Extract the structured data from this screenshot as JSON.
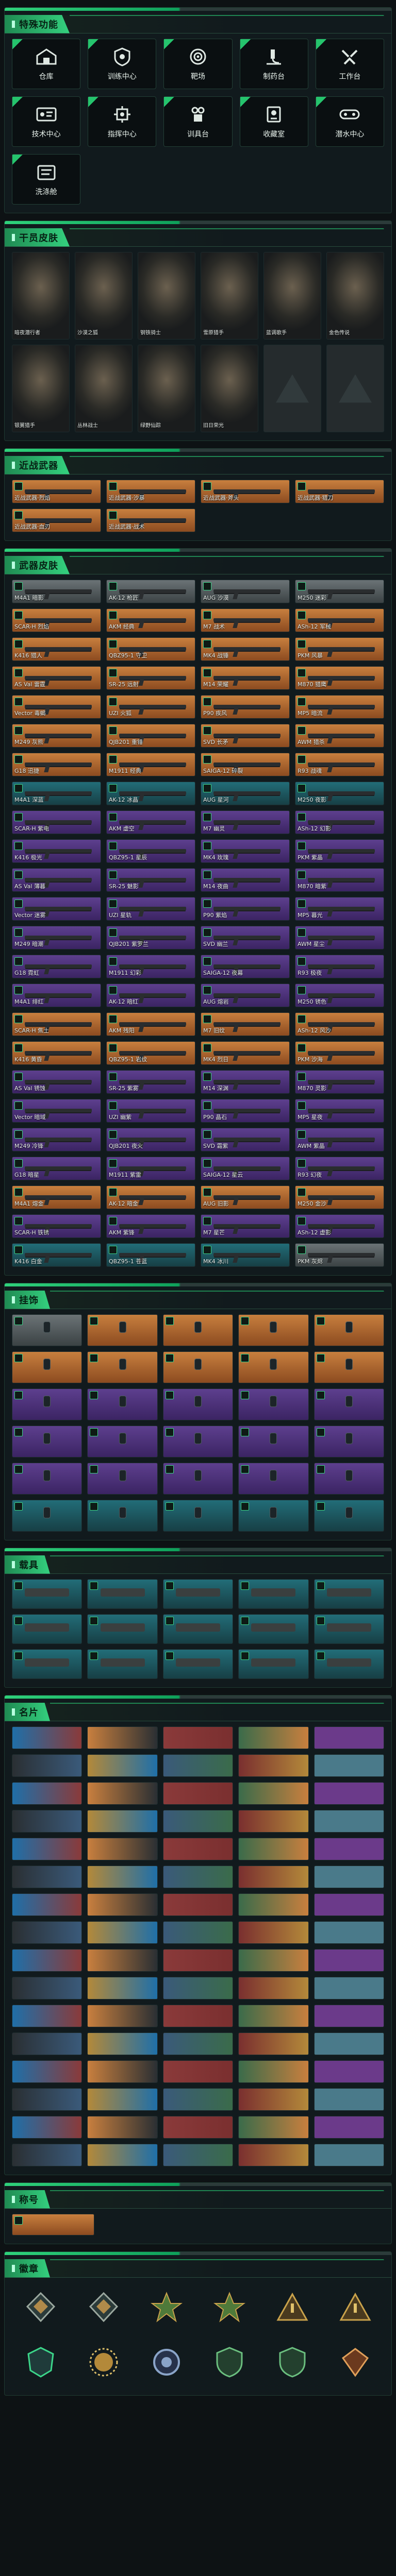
{
  "window": {
    "title": "特殊功能"
  },
  "functions": {
    "title": "特殊功能",
    "items": [
      {
        "label": "仓库",
        "icon": "warehouse-icon"
      },
      {
        "label": "训练中心",
        "icon": "training-icon"
      },
      {
        "label": "靶场",
        "icon": "target-icon"
      },
      {
        "label": "制药台",
        "icon": "microscope-icon"
      },
      {
        "label": "工作台",
        "icon": "workbench-icon"
      },
      {
        "label": "技术中心",
        "icon": "id-card-icon"
      },
      {
        "label": "指挥中心",
        "icon": "chip-icon"
      },
      {
        "label": "训具台",
        "icon": "crafting-icon"
      },
      {
        "label": "收藏室",
        "icon": "collection-icon"
      },
      {
        "label": "潜水中心",
        "icon": "diving-icon"
      },
      {
        "label": "洗涤舱",
        "icon": "wash-icon"
      }
    ]
  },
  "operators": {
    "title": "干员皮肤",
    "items": [
      {
        "label": "暗夜潜行者"
      },
      {
        "label": "沙漠之狐"
      },
      {
        "label": "钢铁骑士"
      },
      {
        "label": "雪原猎手"
      },
      {
        "label": "蓝调歌手"
      },
      {
        "label": "金色传说"
      },
      {
        "label": "银翼猎手"
      },
      {
        "label": "丛林战士"
      },
      {
        "label": "绿野仙踪"
      },
      {
        "label": "旧日荣光"
      },
      {
        "label": ""
      },
      {
        "label": ""
      }
    ]
  },
  "melee": {
    "title": "近战武器",
    "items": [
      {
        "label": "近战武器·烈焰",
        "q": "orange"
      },
      {
        "label": "近战武器·沙暴",
        "q": "orange"
      },
      {
        "label": "近战武器·斧头",
        "q": "orange"
      },
      {
        "label": "近战武器·猎刀",
        "q": "orange"
      },
      {
        "label": "近战武器·血刃",
        "q": "orange"
      },
      {
        "label": "近战武器·战术",
        "q": "orange"
      }
    ]
  },
  "weapons": {
    "title": "武器皮肤",
    "items": [
      {
        "label": "M4A1 暗影",
        "q": "gray"
      },
      {
        "label": "AK-12 枪匠",
        "q": "gray"
      },
      {
        "label": "AUG 沙漠",
        "q": "gray"
      },
      {
        "label": "M250 迷彩",
        "q": "gray"
      },
      {
        "label": "SCAR-H 烈焰",
        "q": "orange"
      },
      {
        "label": "AKM 经典",
        "q": "orange"
      },
      {
        "label": "M7 战术",
        "q": "orange"
      },
      {
        "label": "ASh-12 军械",
        "q": "orange"
      },
      {
        "label": "K416 猎人",
        "q": "orange"
      },
      {
        "label": "QBZ95-1 守卫",
        "q": "orange"
      },
      {
        "label": "MK4 战锤",
        "q": "orange"
      },
      {
        "label": "PKM 风暴",
        "q": "orange"
      },
      {
        "label": "AS Val 雷霆",
        "q": "orange"
      },
      {
        "label": "SR-25 远射",
        "q": "orange"
      },
      {
        "label": "M14 荣耀",
        "q": "orange"
      },
      {
        "label": "M870 猎鹰",
        "q": "orange"
      },
      {
        "label": "Vector 毒蝎",
        "q": "orange"
      },
      {
        "label": "UZI 火狐",
        "q": "orange"
      },
      {
        "label": "P90 疾风",
        "q": "orange"
      },
      {
        "label": "MP5 暗流",
        "q": "orange"
      },
      {
        "label": "M249 灰熊",
        "q": "orange"
      },
      {
        "label": "QJB201 重锤",
        "q": "orange"
      },
      {
        "label": "SVD 长矛",
        "q": "orange"
      },
      {
        "label": "AWM 猎杀",
        "q": "orange"
      },
      {
        "label": "G18 迅捷",
        "q": "orange"
      },
      {
        "label": "M1911 经典",
        "q": "orange"
      },
      {
        "label": "SAIGA-12 碎裂",
        "q": "orange"
      },
      {
        "label": "R93 战魂",
        "q": "orange"
      },
      {
        "label": "M4A1 深蓝",
        "q": "blue"
      },
      {
        "label": "AK-12 冰晶",
        "q": "blue"
      },
      {
        "label": "AUG 星河",
        "q": "blue"
      },
      {
        "label": "M250 夜影",
        "q": "blue"
      },
      {
        "label": "SCAR-H 紫电",
        "q": "purple"
      },
      {
        "label": "AKM 虚空",
        "q": "purple"
      },
      {
        "label": "M7 幽灵",
        "q": "purple"
      },
      {
        "label": "ASh-12 幻影",
        "q": "purple"
      },
      {
        "label": "K416 极光",
        "q": "purple"
      },
      {
        "label": "QBZ95-1 星辰",
        "q": "purple"
      },
      {
        "label": "MK4 玫瑰",
        "q": "purple"
      },
      {
        "label": "PKM 紫晶",
        "q": "purple"
      },
      {
        "label": "AS Val 薄暮",
        "q": "purple"
      },
      {
        "label": "SR-25 魅影",
        "q": "purple"
      },
      {
        "label": "M14 夜曲",
        "q": "purple"
      },
      {
        "label": "M870 暗紫",
        "q": "purple"
      },
      {
        "label": "Vector 迷雾",
        "q": "purple"
      },
      {
        "label": "UZI 星轨",
        "q": "purple"
      },
      {
        "label": "P90 紫焰",
        "q": "purple"
      },
      {
        "label": "MP5 暮光",
        "q": "purple"
      },
      {
        "label": "M249 暗潮",
        "q": "purple"
      },
      {
        "label": "QJB201 紫罗兰",
        "q": "purple"
      },
      {
        "label": "SVD 幽兰",
        "q": "purple"
      },
      {
        "label": "AWM 星尘",
        "q": "purple"
      },
      {
        "label": "G18 霓虹",
        "q": "purple"
      },
      {
        "label": "M1911 幻彩",
        "q": "purple"
      },
      {
        "label": "SAIGA-12 夜幕",
        "q": "purple"
      },
      {
        "label": "R93 极夜",
        "q": "purple"
      },
      {
        "label": "M4A1 绯红",
        "q": "purple"
      },
      {
        "label": "AK-12 暗红",
        "q": "purple"
      },
      {
        "label": "AUG 熔岩",
        "q": "purple"
      },
      {
        "label": "M250 锈色",
        "q": "purple"
      },
      {
        "label": "SCAR-H 焦土",
        "q": "orange"
      },
      {
        "label": "AKM 残阳",
        "q": "orange"
      },
      {
        "label": "M7 旧纹",
        "q": "orange"
      },
      {
        "label": "ASh-12 风沙",
        "q": "orange"
      },
      {
        "label": "K416 黄昏",
        "q": "orange"
      },
      {
        "label": "QBZ95-1 岩纹",
        "q": "orange"
      },
      {
        "label": "MK4 烈日",
        "q": "orange"
      },
      {
        "label": "PKM 沙海",
        "q": "orange"
      },
      {
        "label": "AS Val 锈蚀",
        "q": "purple"
      },
      {
        "label": "SR-25 紫雾",
        "q": "purple"
      },
      {
        "label": "M14 深渊",
        "q": "purple"
      },
      {
        "label": "M870 灵影",
        "q": "purple"
      },
      {
        "label": "Vector 暗域",
        "q": "purple"
      },
      {
        "label": "UZI 幽紫",
        "q": "purple"
      },
      {
        "label": "P90 晶石",
        "q": "purple"
      },
      {
        "label": "MP5 星夜",
        "q": "purple"
      },
      {
        "label": "M249 冷锋",
        "q": "purple"
      },
      {
        "label": "QJB201 夜火",
        "q": "purple"
      },
      {
        "label": "SVD 霜紫",
        "q": "purple"
      },
      {
        "label": "AWM 紫晶",
        "q": "purple"
      },
      {
        "label": "G18 暗星",
        "q": "purple"
      },
      {
        "label": "M1911 紫雷",
        "q": "purple"
      },
      {
        "label": "SAIGA-12 星云",
        "q": "purple"
      },
      {
        "label": "R93 幻夜",
        "q": "purple"
      },
      {
        "label": "M4A1 熔金",
        "q": "orange"
      },
      {
        "label": "AK-12 暗金",
        "q": "orange"
      },
      {
        "label": "AUG 旧影",
        "q": "orange"
      },
      {
        "label": "M250 金沙",
        "q": "orange"
      },
      {
        "label": "SCAR-H 铁锈",
        "q": "purple"
      },
      {
        "label": "AKM 紫锋",
        "q": "purple"
      },
      {
        "label": "M7 星芒",
        "q": "purple"
      },
      {
        "label": "ASh-12 虚影",
        "q": "purple"
      },
      {
        "label": "K416 白金",
        "q": "blue"
      },
      {
        "label": "QBZ95-1 苍蓝",
        "q": "blue"
      },
      {
        "label": "MK4 冰川",
        "q": "blue"
      },
      {
        "label": "PKM 灰烬",
        "q": "gray"
      }
    ]
  },
  "charms": {
    "title": "挂饰",
    "items": [
      {
        "label": "",
        "q": "gray"
      },
      {
        "label": "",
        "q": "orange"
      },
      {
        "label": "",
        "q": "orange"
      },
      {
        "label": "",
        "q": "orange"
      },
      {
        "label": "",
        "q": "orange"
      },
      {
        "label": "",
        "q": "orange"
      },
      {
        "label": "",
        "q": "orange"
      },
      {
        "label": "",
        "q": "orange"
      },
      {
        "label": "",
        "q": "orange"
      },
      {
        "label": "",
        "q": "orange"
      },
      {
        "label": "",
        "q": "purple"
      },
      {
        "label": "",
        "q": "purple"
      },
      {
        "label": "",
        "q": "purple"
      },
      {
        "label": "",
        "q": "purple"
      },
      {
        "label": "",
        "q": "purple"
      },
      {
        "label": "",
        "q": "purple"
      },
      {
        "label": "",
        "q": "purple"
      },
      {
        "label": "",
        "q": "purple"
      },
      {
        "label": "",
        "q": "purple"
      },
      {
        "label": "",
        "q": "purple"
      },
      {
        "label": "",
        "q": "purple"
      },
      {
        "label": "",
        "q": "purple"
      },
      {
        "label": "",
        "q": "purple"
      },
      {
        "label": "",
        "q": "purple"
      },
      {
        "label": "",
        "q": "purple"
      },
      {
        "label": "",
        "q": "blue"
      },
      {
        "label": "",
        "q": "blue"
      },
      {
        "label": "",
        "q": "blue"
      },
      {
        "label": "",
        "q": "blue"
      },
      {
        "label": "",
        "q": "blue"
      }
    ]
  },
  "vehicles": {
    "title": "载具",
    "items": [
      {
        "label": "",
        "q": "blue"
      },
      {
        "label": "",
        "q": "blue"
      },
      {
        "label": "",
        "q": "blue"
      },
      {
        "label": "",
        "q": "blue"
      },
      {
        "label": "",
        "q": "blue"
      },
      {
        "label": "",
        "q": "blue"
      },
      {
        "label": "",
        "q": "blue"
      },
      {
        "label": "",
        "q": "blue"
      },
      {
        "label": "",
        "q": "blue"
      },
      {
        "label": "",
        "q": "blue"
      },
      {
        "label": "",
        "q": "blue"
      },
      {
        "label": "",
        "q": "blue"
      },
      {
        "label": "",
        "q": "blue"
      },
      {
        "label": "",
        "q": "blue"
      },
      {
        "label": "",
        "q": "blue"
      }
    ]
  },
  "cards": {
    "title": "名片",
    "count": 80
  },
  "titles": {
    "title": "称号",
    "items": [
      {
        "label": ""
      }
    ]
  },
  "emblems": {
    "title": "徽章",
    "items": [
      {
        "label": "",
        "kind": "frame"
      },
      {
        "label": "",
        "kind": "frame"
      },
      {
        "label": "",
        "kind": "star"
      },
      {
        "label": "",
        "kind": "star"
      },
      {
        "label": "",
        "kind": "tri"
      },
      {
        "label": "",
        "kind": "tri"
      },
      {
        "label": "",
        "kind": "crest"
      },
      {
        "label": "",
        "kind": "sun"
      },
      {
        "label": "",
        "kind": "ring"
      },
      {
        "label": "",
        "kind": "shield"
      },
      {
        "label": "",
        "kind": "shield"
      },
      {
        "label": "",
        "kind": "gem"
      }
    ]
  },
  "colors": {
    "accent": "#2fd27b",
    "accent_dark": "#1f8a52",
    "q_orange": "#c87f3e",
    "q_purple": "#5d3f8e",
    "q_blue": "#226d78",
    "q_gray": "#6b7376"
  }
}
